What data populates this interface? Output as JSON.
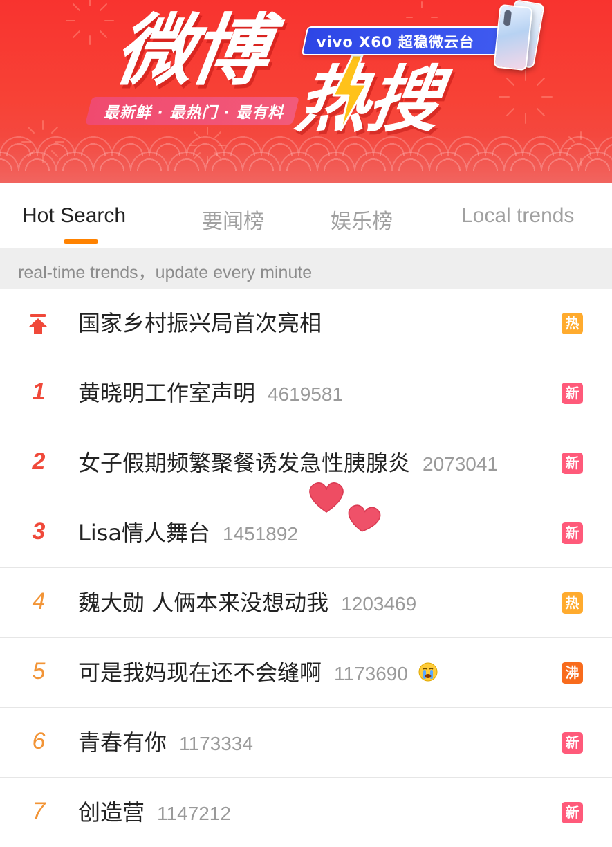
{
  "banner": {
    "title_line1": "微博",
    "title_line2": "热搜",
    "slogan": "最新鲜 · 最热门 · 最有料",
    "sponsor": "vivo X60 超稳微云台"
  },
  "tabs": [
    {
      "label": "Hot Search",
      "active": true
    },
    {
      "label": "要闻榜",
      "active": false
    },
    {
      "label": "娱乐榜",
      "active": false
    },
    {
      "label": "Local trends",
      "active": false
    }
  ],
  "notice": "real-time trends，update every minute",
  "list": [
    {
      "rank_icon": "pin-to-top-icon",
      "title": "国家乡村振兴局首次亮相",
      "count": "",
      "badge": "热",
      "badge_color": "#ffab2e"
    },
    {
      "rank": "1",
      "title": "黄晓明工作室声明",
      "count": "4619581",
      "badge": "新",
      "badge_color": "#ff5a7a"
    },
    {
      "rank": "2",
      "title": "女子假期频繁聚餐诱发急性胰腺炎",
      "count": "2073041",
      "badge": "新",
      "badge_color": "#ff5a7a"
    },
    {
      "rank": "3",
      "title": "Lisa情人舞台",
      "count": "1451892",
      "badge": "新",
      "badge_color": "#ff5a7a"
    },
    {
      "rank": "4",
      "title": "魏大勋 人俩本来没想动我",
      "count": "1203469",
      "badge": "热",
      "badge_color": "#ffab2e"
    },
    {
      "rank": "5",
      "title": "可是我妈现在还不会缝啊",
      "count": "1173690",
      "emoji": "crying-face-icon",
      "badge": "沸",
      "badge_color": "#f86b1c"
    },
    {
      "rank": "6",
      "title": "青春有你",
      "count": "1173334",
      "badge": "新",
      "badge_color": "#ff5a7a"
    },
    {
      "rank": "7",
      "title": "创造营",
      "count": "1147212",
      "badge": "新",
      "badge_color": "#ff5a7a"
    }
  ],
  "colors": {
    "accent": "#ff8200",
    "rank_top3": "#f0493a",
    "rank_rest": "#f29436",
    "banner_red": "#f8332f"
  }
}
